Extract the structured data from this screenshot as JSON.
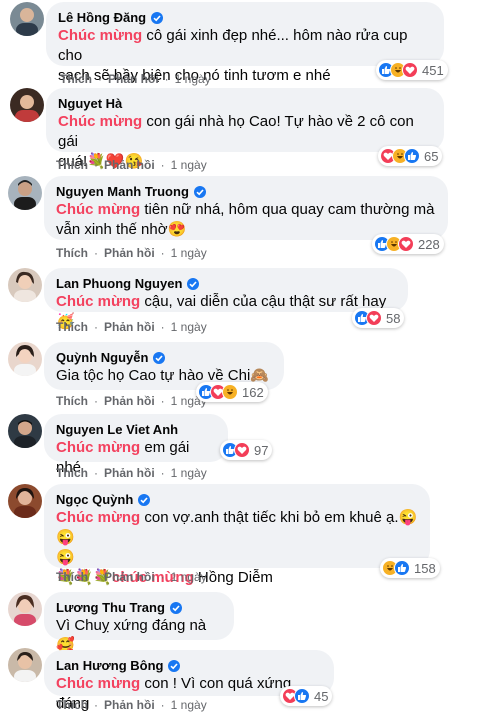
{
  "labels": {
    "like": "Thích",
    "reply": "Phản hồi",
    "dot": "·"
  },
  "colors": {
    "highlight": "#f3425f",
    "bubble": "#f0f2f5",
    "meta": "#65676b",
    "like": "#1877f2",
    "love": "#f33e58",
    "haha": "#f7b125",
    "verified": "#1877f2"
  },
  "comments": [
    {
      "author": "Lê Hồng Đăng",
      "verified": true,
      "hl": "Chúc mừng",
      "text1": " cô gái xinh đẹp nhé... hôm nào rửa cup cho",
      "text2": "sạch sẽ bầy biện cho nó tinh tươm e nhé",
      "time": "1 ngày",
      "reactions": [
        "like-icon",
        "haha-icon",
        "love-icon"
      ],
      "count": "451"
    },
    {
      "author": "Nguyet Hà",
      "verified": false,
      "hl": "Chúc mừng",
      "text1": " con gái nhà họ Cao! Tự hào về 2 cô con gái",
      "text2": "quá!💐❤️😘",
      "time": "1 ngày",
      "reactions": [
        "love-icon",
        "haha-icon",
        "like-icon"
      ],
      "count": "65"
    },
    {
      "author": "Nguyen Manh Truong",
      "verified": true,
      "hl": "Chúc mừng",
      "text1": " tiên nữ nhá, hôm qua quay cam thường mà",
      "text2": "vẫn xinh thế nhờ😍",
      "time": "1 ngày",
      "reactions": [
        "like-icon",
        "haha-icon",
        "love-icon"
      ],
      "count": "228"
    },
    {
      "author": "Lan Phuong Nguyen",
      "verified": true,
      "hl": "Chúc mừng",
      "text1": " cậu, vai diễn của cậu thật sư rất hay 🥳",
      "text2": "",
      "time": "1 ngày",
      "reactions": [
        "like-icon",
        "love-icon"
      ],
      "count": "58"
    },
    {
      "author": "Quỳnh Nguyễn",
      "verified": true,
      "hl": "",
      "text1": "Gia tộc họ Cao tự hào về Chi🙈",
      "text2": "",
      "time": "1 ngày",
      "reactions": [
        "like-icon",
        "love-icon",
        "haha-icon"
      ],
      "count": "162"
    },
    {
      "author": "Nguyen Le Viet Anh",
      "verified": false,
      "hl": "Chúc mừng",
      "text1": " em gái nhé",
      "text2": "",
      "time": "1 ngày",
      "reactions": [
        "like-icon",
        "love-icon"
      ],
      "count": "97"
    },
    {
      "author": "Ngọc Quỳnh",
      "verified": true,
      "hl": "Chúc mừng",
      "text1": " con vợ.anh thật tiếc khi bỏ em khuê ạ.😜😜",
      "text2": "😜",
      "text3_pre": "💐💐💐",
      "text3_hl": "chúc mừng",
      "text3_post": " Hồng Diễm",
      "time": "1 ngày",
      "reactions": [
        "haha-icon",
        "like-icon"
      ],
      "count": "158"
    },
    {
      "author": "Lương Thu Trang",
      "verified": true,
      "hl": "",
      "text1": "Vì Chuỵ xứng đáng nà🥰",
      "text2": "",
      "time": "",
      "reactions": [],
      "count": ""
    },
    {
      "author": "Lan Hương Bông",
      "verified": true,
      "hl": "Chúc mừng",
      "text1": " con ! Vì con quá xứng đáng",
      "text2": "",
      "time": "1 ngày",
      "reactions": [
        "love-icon",
        "like-icon"
      ],
      "count": "45"
    }
  ]
}
